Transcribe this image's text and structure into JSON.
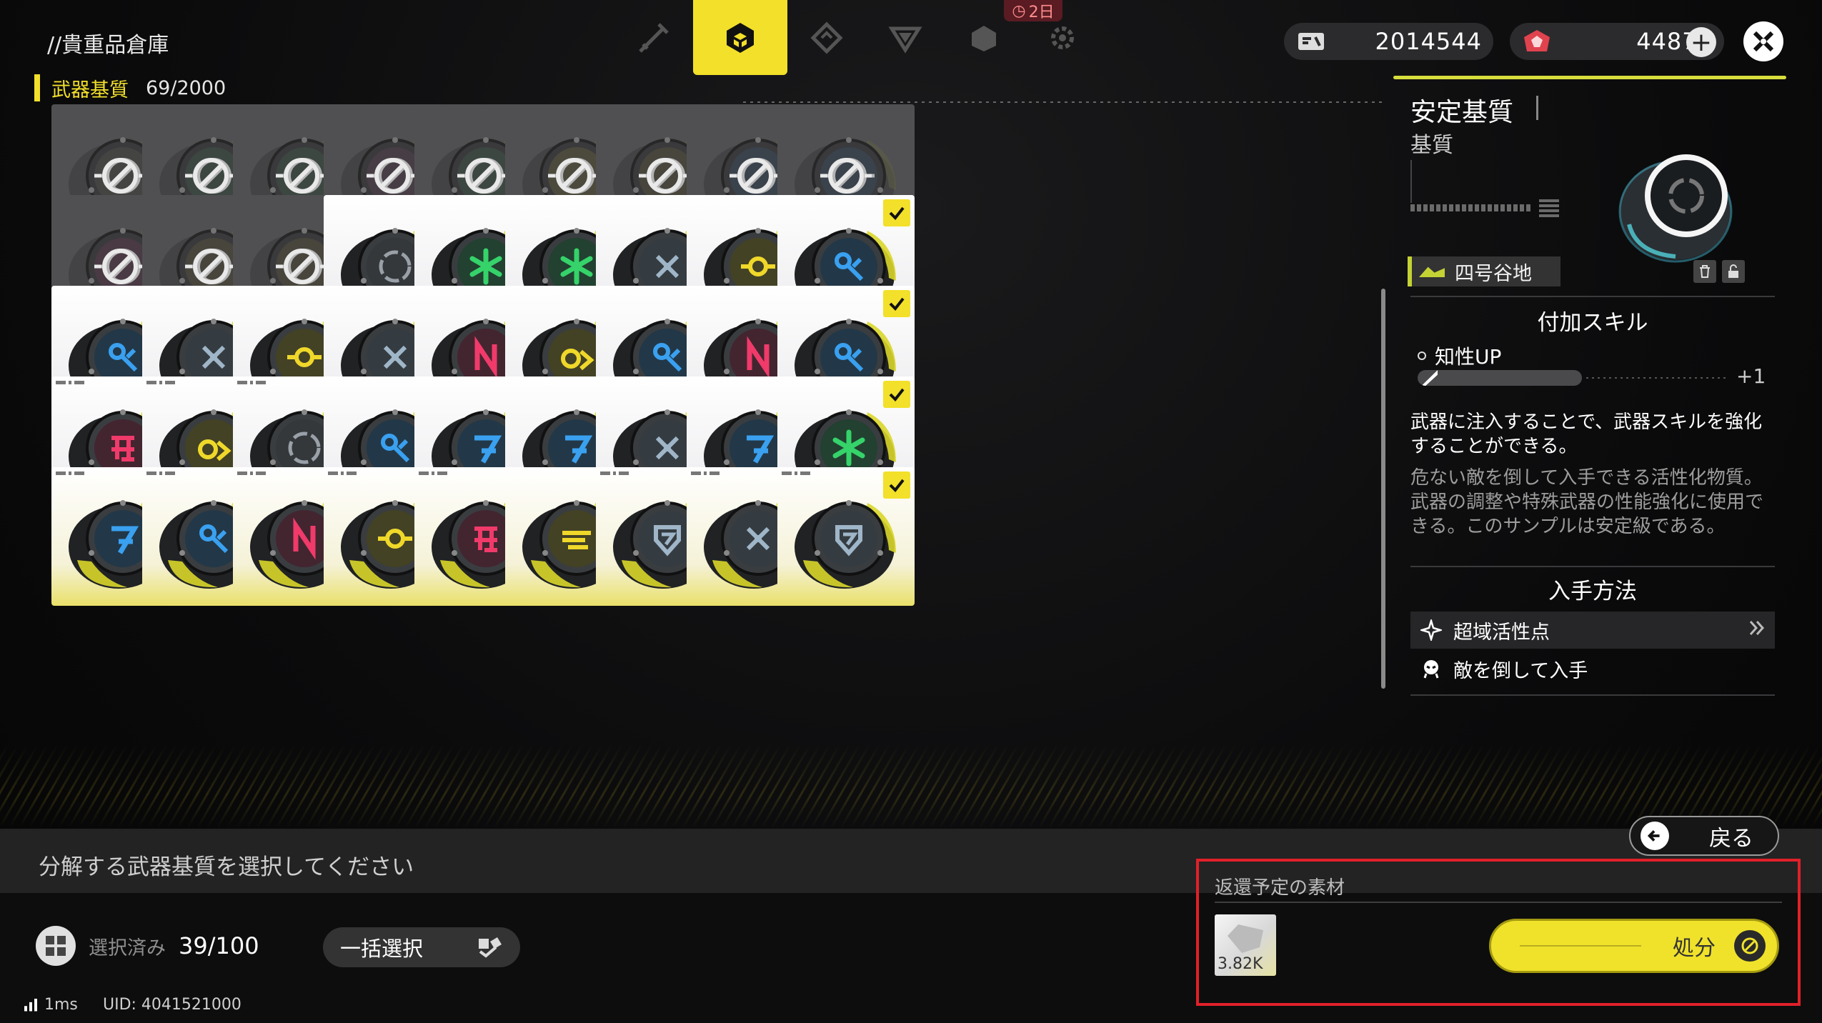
{
  "header": {
    "title": "//貴重品倉庫",
    "timer_badge": "2日",
    "tabs": [
      {
        "name": "tab-weapons",
        "icon": "sword-icon"
      },
      {
        "name": "tab-matrix",
        "icon": "cube-icon",
        "active": true
      },
      {
        "name": "tab-module",
        "icon": "diamond-chevron-icon"
      },
      {
        "name": "tab-gem",
        "icon": "gem-icon"
      },
      {
        "name": "tab-pack",
        "icon": "pack-icon"
      },
      {
        "name": "tab-gear",
        "icon": "gear-icon"
      }
    ],
    "currency_1": {
      "icon": "credit-card-icon",
      "value": "2014544"
    },
    "currency_2": {
      "icon": "crystal-icon",
      "value": "44870"
    }
  },
  "category": {
    "name": "武器基質",
    "count": "69/2000"
  },
  "grid": {
    "rows": [
      [
        {
          "s": "d",
          "sym": "none",
          "c": "#7a8060"
        },
        {
          "s": "d",
          "sym": "none",
          "c": "#4a8a5a"
        },
        {
          "s": "d",
          "sym": "none",
          "c": "#4a8a5a"
        },
        {
          "s": "d",
          "sym": "none",
          "c": "#8a4a70"
        },
        {
          "s": "d",
          "sym": "none",
          "c": "#4a8a5a"
        },
        {
          "s": "d",
          "sym": "none",
          "c": "#b0a040",
          "lock": true,
          "corner": true
        },
        {
          "s": "d",
          "sym": "none",
          "c": "#8a8040"
        },
        {
          "s": "d",
          "sym": "none",
          "c": "#3a6a9a"
        },
        {
          "s": "d",
          "sym": "none",
          "c": "#3a6a9a"
        }
      ],
      [
        {
          "s": "d",
          "sym": "none",
          "c": "#9a3a6a"
        },
        {
          "s": "d",
          "sym": "none",
          "c": "#8a8040"
        },
        {
          "s": "d",
          "sym": "none",
          "c": "#8a8040"
        },
        {
          "s": "s",
          "sym": "ring",
          "c": "#9aa0a8"
        },
        {
          "s": "s",
          "sym": "star",
          "c": "#35d36a"
        },
        {
          "s": "s",
          "sym": "star",
          "c": "#35d36a"
        },
        {
          "s": "s",
          "sym": "cross",
          "c": "#9fb5c8"
        },
        {
          "s": "s",
          "sym": "dot",
          "c": "#f0d82a"
        },
        {
          "s": "s",
          "sym": "key",
          "c": "#3aa0f0"
        }
      ],
      [
        {
          "s": "s",
          "sym": "key",
          "c": "#3aa0f0"
        },
        {
          "s": "s",
          "sym": "cross",
          "c": "#9fb5c8"
        },
        {
          "s": "s",
          "sym": "dot",
          "c": "#f0d82a"
        },
        {
          "s": "s",
          "sym": "cross",
          "c": "#9fb5c8"
        },
        {
          "s": "s",
          "sym": "n",
          "c": "#f03a6a"
        },
        {
          "s": "s",
          "sym": "oarrow",
          "c": "#f0d82a"
        },
        {
          "s": "s",
          "sym": "key",
          "c": "#3aa0f0"
        },
        {
          "s": "s",
          "sym": "n",
          "c": "#f03a6a"
        },
        {
          "s": "s",
          "sym": "key",
          "c": "#3aa0f0"
        }
      ],
      [
        {
          "s": "s",
          "sym": "glyph",
          "c": "#f03a6a",
          "tag": true
        },
        {
          "s": "s",
          "sym": "oarrow",
          "c": "#f0d82a",
          "tag": true
        },
        {
          "s": "s",
          "sym": "ring",
          "c": "#9aa0a8",
          "tag": true
        },
        {
          "s": "s",
          "sym": "key",
          "c": "#3aa0f0"
        },
        {
          "s": "s",
          "sym": "seven",
          "c": "#3aa0f0"
        },
        {
          "s": "s",
          "sym": "seven",
          "c": "#3aa0f0"
        },
        {
          "s": "s",
          "sym": "cross",
          "c": "#9fb5c8"
        },
        {
          "s": "s",
          "sym": "seven",
          "c": "#3aa0f0"
        },
        {
          "s": "s",
          "sym": "star",
          "c": "#35d36a"
        }
      ],
      [
        {
          "s": "y",
          "sym": "seven",
          "c": "#3aa0f0",
          "tag": true
        },
        {
          "s": "y",
          "sym": "key",
          "c": "#3aa0f0",
          "tag": true
        },
        {
          "s": "y",
          "sym": "n",
          "c": "#f03a6a",
          "tag": true
        },
        {
          "s": "y",
          "sym": "dot",
          "c": "#f0d82a",
          "tag": true
        },
        {
          "s": "y",
          "sym": "glyph",
          "c": "#f03a6a",
          "tag": true
        },
        {
          "s": "y",
          "sym": "bars",
          "c": "#f0d82a",
          "nocheck": true
        },
        {
          "s": "y",
          "sym": "shield",
          "c": "#9fb5c8",
          "tag": true
        },
        {
          "s": "y",
          "sym": "cross",
          "c": "#9fb5c8",
          "tag": true
        },
        {
          "s": "y",
          "sym": "shield",
          "c": "#9fb5c8",
          "tag": true
        }
      ]
    ]
  },
  "detail": {
    "title": "安定基質",
    "type": "基質",
    "location": "四号谷地",
    "skill_section": "付加スキル",
    "skill_name": "知性UP",
    "skill_plus": "+1",
    "desc_primary": "武器に注入することで、武器スキルを強化することができる。",
    "desc_secondary": "危ない敵を倒して入手できる活性化物質。武器の調整や特殊武器の性能強化に使用できる。このサンプルは安定級である。",
    "source_section": "入手方法",
    "sources": [
      {
        "label": "超域活性点",
        "icon": "sparkle-icon"
      },
      {
        "label": "敵を倒して入手",
        "icon": "enemy-icon"
      }
    ]
  },
  "bottom": {
    "back_label": "戻る",
    "prompt": "分解する武器基質を選択してください",
    "selected_label": "選択済み",
    "selected_value": "39/100",
    "bulk_label": "一括選択",
    "ping": "1ms",
    "uid": "UID: 4041521000",
    "return_title": "返還予定の素材",
    "return_amount": "3.82K",
    "dispose_label": "処分"
  }
}
